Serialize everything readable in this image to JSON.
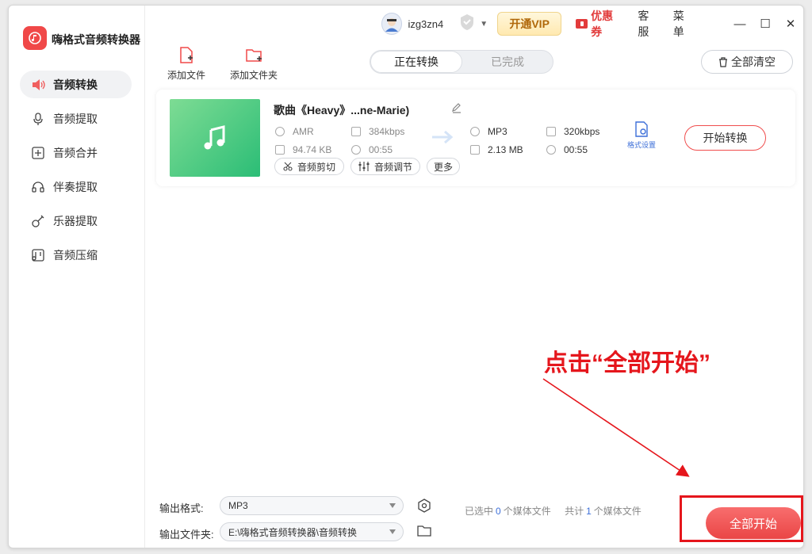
{
  "app": {
    "name": "嗨格式音频转换器"
  },
  "sidebar": {
    "items": [
      {
        "label": "音频转换",
        "icon": "speaker-icon",
        "active": true
      },
      {
        "label": "音频提取",
        "icon": "mic-icon"
      },
      {
        "label": "音频合并",
        "icon": "merge-icon"
      },
      {
        "label": "伴奏提取",
        "icon": "headset-icon"
      },
      {
        "label": "乐器提取",
        "icon": "guitar-icon"
      },
      {
        "label": "音频压缩",
        "icon": "compress-icon"
      }
    ]
  },
  "header": {
    "username": "izg3zn4",
    "vip_label": "开通VIP",
    "coupon_label": "优惠券",
    "service_label": "客服",
    "menu_label": "菜单"
  },
  "toolbar": {
    "add_file": "添加文件",
    "add_folder": "添加文件夹",
    "tab_converting": "正在转换",
    "tab_done": "已完成",
    "clear_all": "全部清空"
  },
  "file": {
    "title": "歌曲《Heavy》...ne-Marie)",
    "source": {
      "format": "AMR",
      "bitrate": "384kbps",
      "size": "94.74 KB",
      "duration": "00:55"
    },
    "target": {
      "format": "MP3",
      "bitrate": "320kbps",
      "size": "2.13 MB",
      "duration": "00:55"
    },
    "format_settings": "格式设置",
    "start_label": "开始转换",
    "chips": {
      "cut": "音频剪切",
      "adjust": "音频调节",
      "more": "更多"
    }
  },
  "annotation": {
    "text": "点击“全部开始”",
    "color": "#e5161c"
  },
  "bottom": {
    "output_format_label": "输出格式:",
    "output_format_value": "MP3",
    "output_folder_label": "输出文件夹:",
    "output_folder_value": "E:\\嗨格式音频转换器\\音频转换",
    "selected_prefix": "已选中",
    "selected_count": "0",
    "selected_suffix": "个媒体文件",
    "total_prefix": "共计",
    "total_count": "1",
    "total_suffix": "个媒体文件",
    "start_all": "全部开始"
  },
  "colors": {
    "accent": "#f04848",
    "link": "#3d6fd8",
    "vip": "#b0680a"
  }
}
